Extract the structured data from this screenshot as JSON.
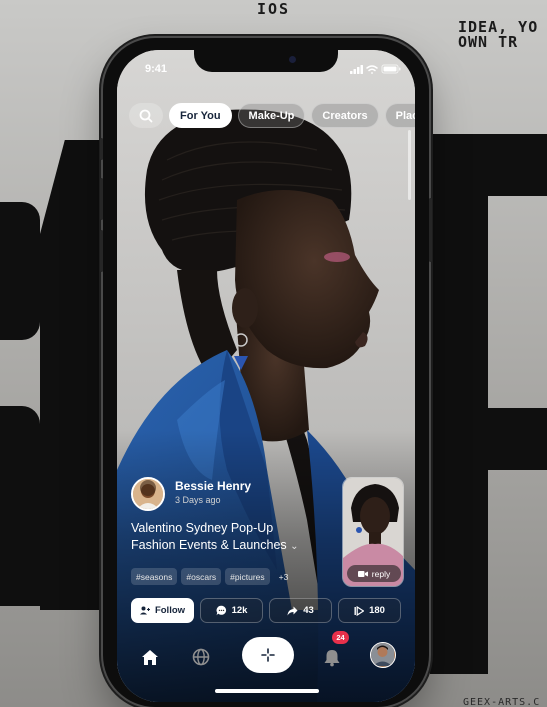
{
  "background": {
    "top_label": "IOS",
    "right_text": "IDEA, YO\nOWN TR",
    "bottom_text": "GEEX-ARTS.C"
  },
  "status_bar": {
    "time": "9:41"
  },
  "categories": {
    "search_icon": "search-icon",
    "tabs": [
      {
        "label": "For You",
        "active": true
      },
      {
        "label": "Make-Up",
        "active": false
      },
      {
        "label": "Creators",
        "active": false
      },
      {
        "label": "Place",
        "active": false
      }
    ]
  },
  "post": {
    "author": {
      "name": "Bessie Henry",
      "time": "3 Days ago"
    },
    "title_line1": "Valentino Sydney Pop-Up",
    "title_line2": "Fashion Events & Launches",
    "title_chevron": "⌄",
    "tags": [
      "#seasons",
      "#oscars",
      "#pictures",
      "+3"
    ],
    "reply_label": "reply"
  },
  "actions": {
    "follow_label": "Follow",
    "comments": "12k",
    "shares": "43",
    "views": "180"
  },
  "tabbar": {
    "items": [
      "home-icon",
      "globe-icon",
      "create-icon",
      "bell-icon",
      "profile-avatar"
    ],
    "notification_count": "24"
  },
  "colors": {
    "accent_navy": "#16243a",
    "badge_red": "#e8304b",
    "jacket_blue": "#1e4c8f"
  }
}
